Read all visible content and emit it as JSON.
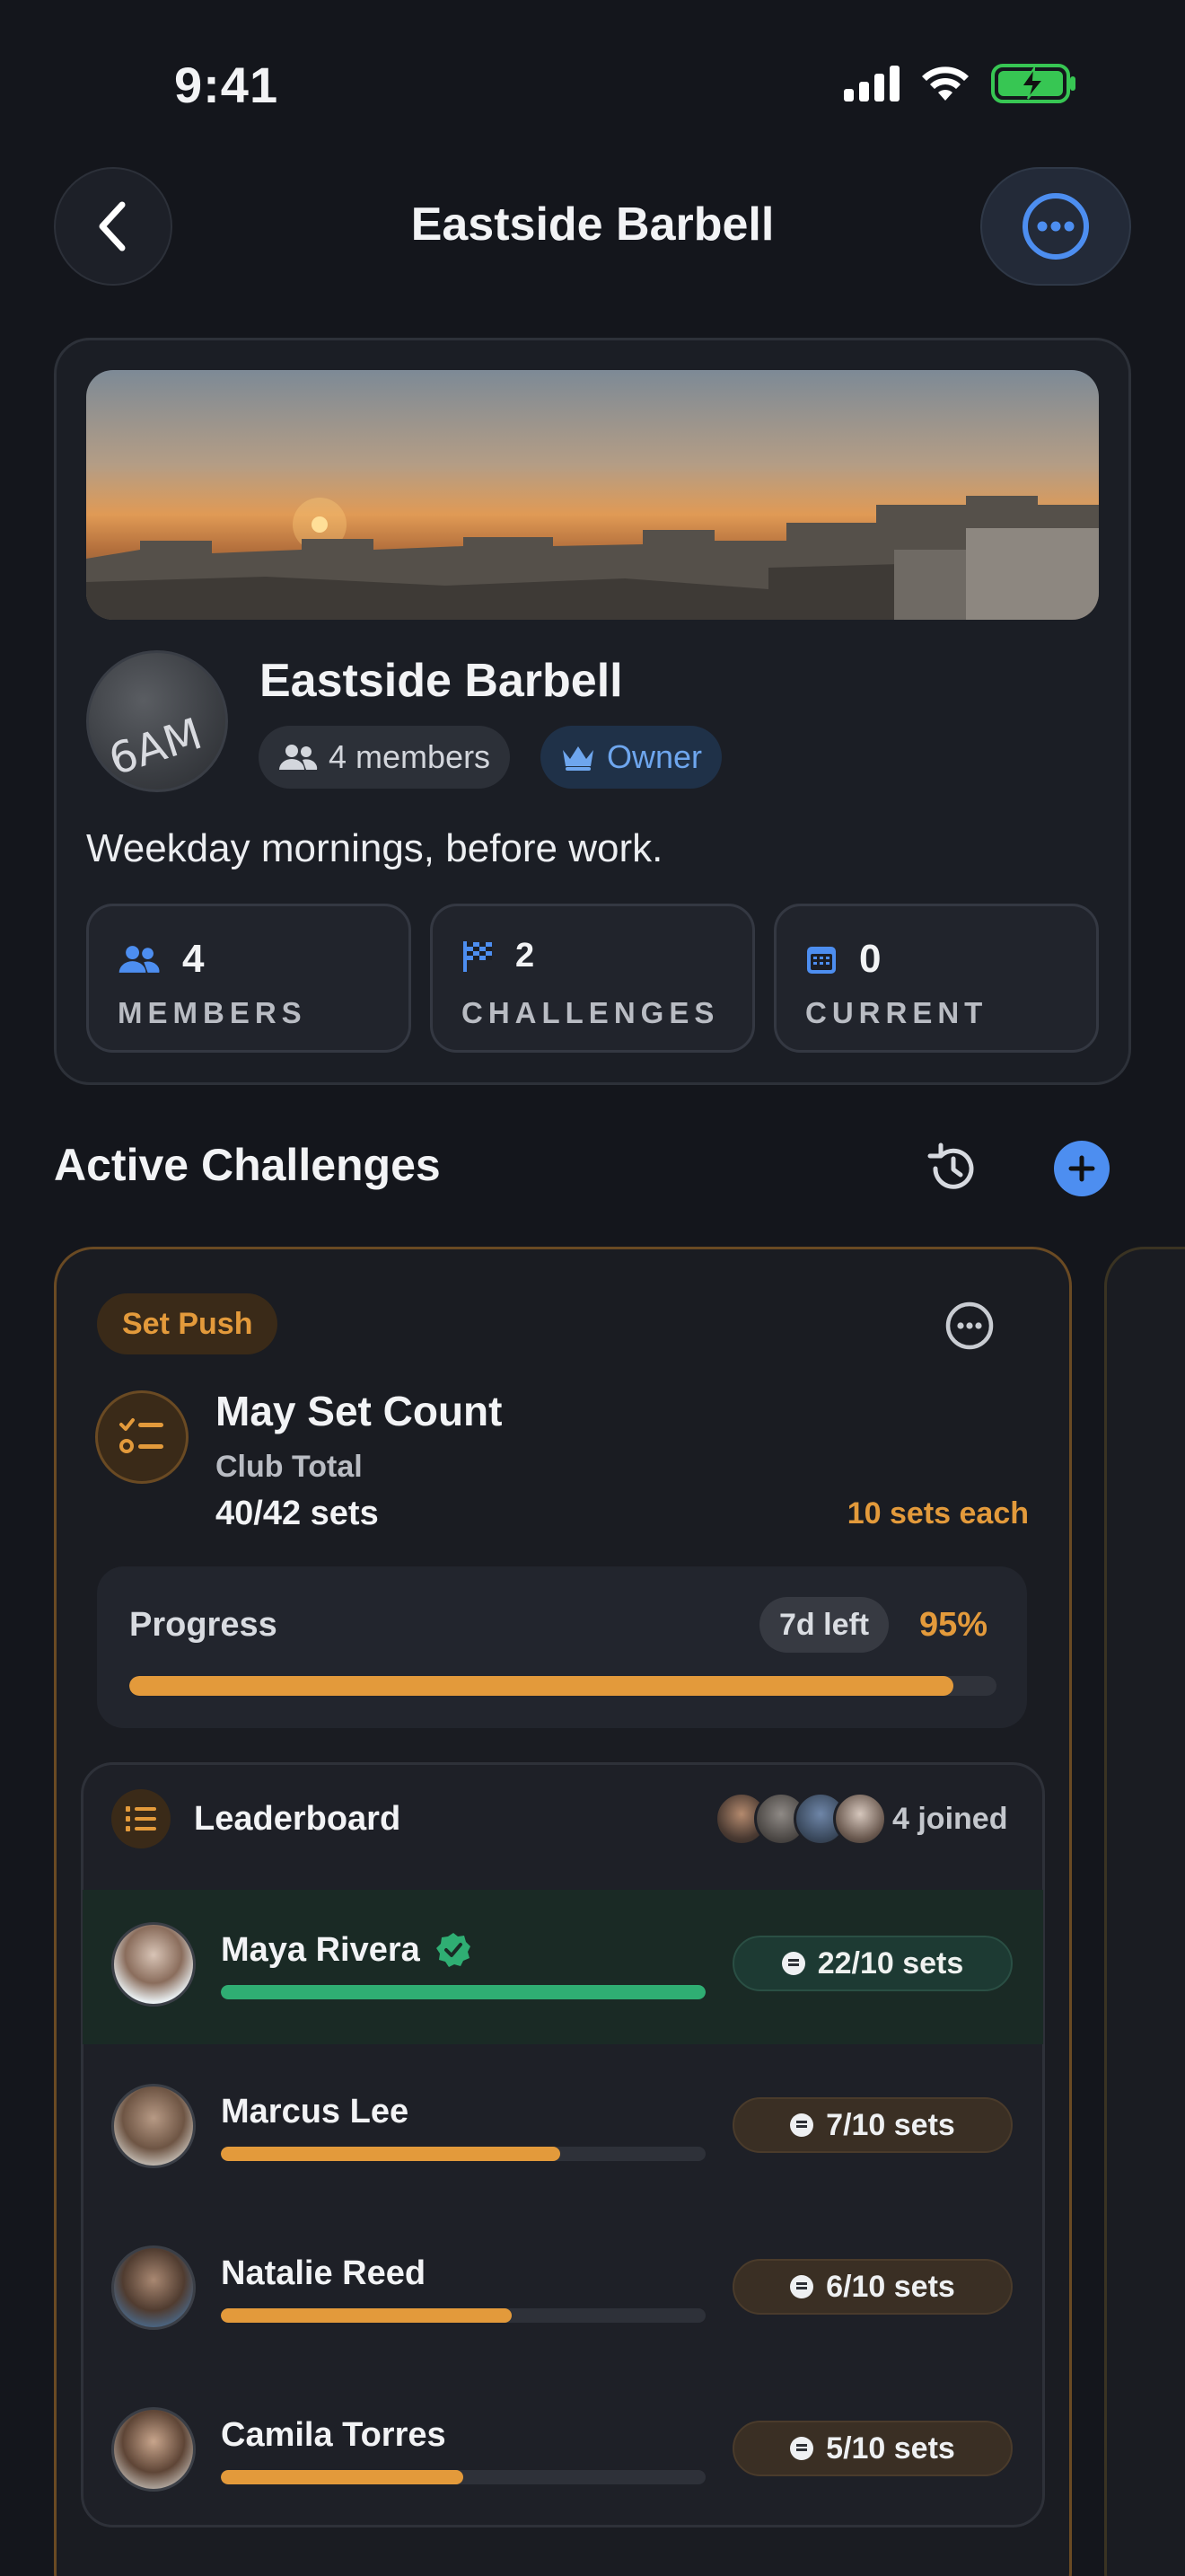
{
  "status_bar": {
    "time": "9:41"
  },
  "header": {
    "title": "Eastside Barbell"
  },
  "club": {
    "name": "Eastside Barbell",
    "avatar_text": "6AM",
    "members_pill": "4 members",
    "owner_pill": "Owner",
    "description": "Weekday mornings, before work.",
    "stats": [
      {
        "value": "4",
        "label": "MEMBERS",
        "icon": "people-icon"
      },
      {
        "value": "2",
        "label": "CHALLENGES",
        "icon": "checkered-flag-icon"
      },
      {
        "value": "0",
        "label": "CURRENT",
        "icon": "calendar-icon"
      }
    ]
  },
  "section": {
    "title": "Active Challenges"
  },
  "challenge": {
    "tag": "Set Push",
    "title": "May Set Count",
    "subtitle": "Club Total",
    "count": "40/42 sets",
    "each": "10 sets each",
    "progress_label": "Progress",
    "days_left": "7d left",
    "percent": "95%",
    "progress_value": 0.95,
    "leaderboard": {
      "title": "Leaderboard",
      "joined": "4 joined",
      "rows": [
        {
          "name": "Maya Rivera",
          "sets": "22/10 sets",
          "progress": 1.0,
          "verified": true
        },
        {
          "name": "Marcus Lee",
          "sets": "7/10 sets",
          "progress": 0.7,
          "verified": false
        },
        {
          "name": "Natalie Reed",
          "sets": "6/10 sets",
          "progress": 0.6,
          "verified": false
        },
        {
          "name": "Camila Torres",
          "sets": "5/10 sets",
          "progress": 0.5,
          "verified": false
        }
      ]
    }
  },
  "colors": {
    "accent": "#e39a3b",
    "blue": "#4d8ef0",
    "green": "#2fae73",
    "background": "#14161c"
  }
}
